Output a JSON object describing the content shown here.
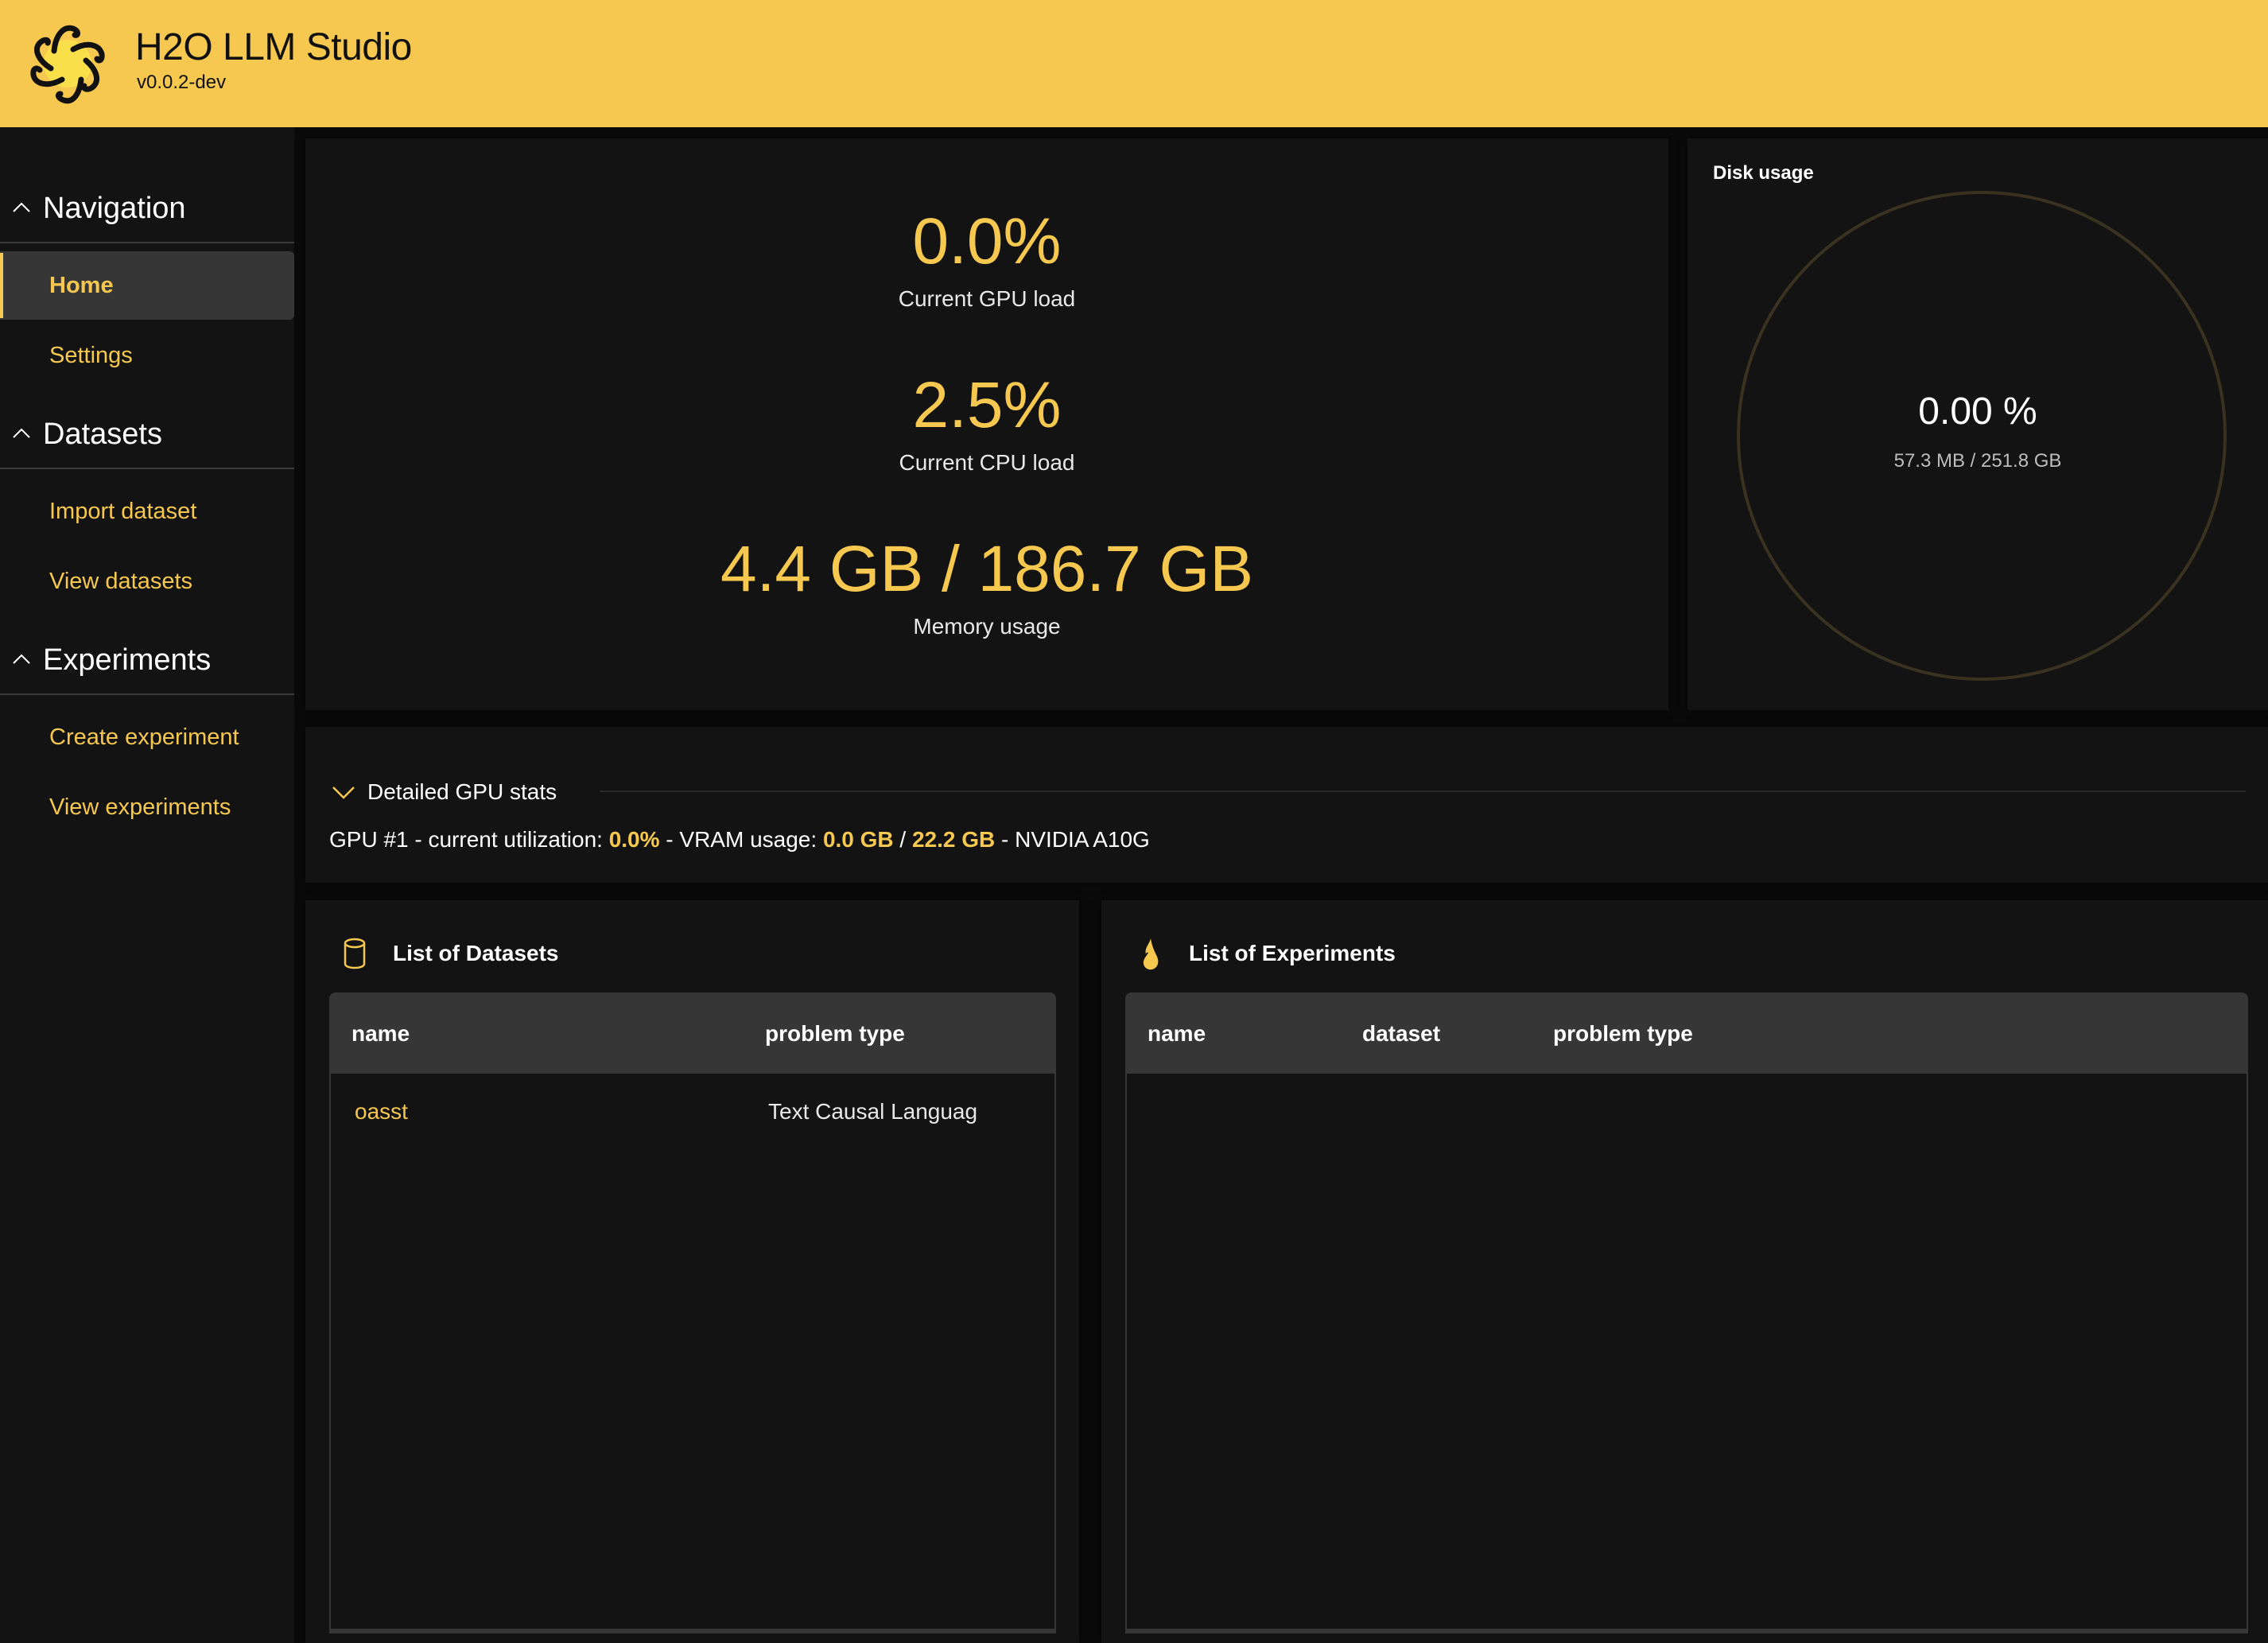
{
  "header": {
    "title": "H2O LLM Studio",
    "version": "v0.0.2-dev",
    "logo_icon": "h2o-spiral-logo",
    "background_color": "#F6C84F"
  },
  "sidebar": {
    "sections": [
      {
        "label": "Navigation",
        "icon": "chevron-up-icon",
        "items": [
          {
            "label": "Home",
            "active": true
          },
          {
            "label": "Settings",
            "active": false
          }
        ]
      },
      {
        "label": "Datasets",
        "icon": "chevron-up-icon",
        "items": [
          {
            "label": "Import dataset",
            "active": false
          },
          {
            "label": "View datasets",
            "active": false
          }
        ]
      },
      {
        "label": "Experiments",
        "icon": "chevron-up-icon",
        "items": [
          {
            "label": "Create experiment",
            "active": false
          },
          {
            "label": "View experiments",
            "active": false
          }
        ]
      }
    ]
  },
  "stats": {
    "gpu_load": {
      "value": "0.0%",
      "label": "Current GPU load"
    },
    "cpu_load": {
      "value": "2.5%",
      "label": "Current CPU load"
    },
    "memory": {
      "value": "4.4 GB / 186.7 GB",
      "label": "Memory usage"
    }
  },
  "disk": {
    "title": "Disk usage",
    "percent_text": "0.00 %",
    "detail": "57.3 MB / 251.8 GB",
    "fraction_used": 0.0
  },
  "gpu_stats": {
    "toggle_label": "Detailed GPU stats",
    "toggle_icon": "chevron-down-icon",
    "gpus": [
      {
        "prefix": "GPU #1 - current utilization: ",
        "utilization": "0.0%",
        "vram_label": " - VRAM usage: ",
        "vram_used": "0.0 GB",
        "separator": " / ",
        "vram_total": "22.2 GB",
        "suffix": " - NVIDIA A10G"
      }
    ]
  },
  "datasets": {
    "title": "List of Datasets",
    "icon": "database-icon",
    "columns": [
      "name",
      "problem type"
    ],
    "rows": [
      {
        "name": "oasst",
        "problem_type": "Text Causal Languag"
      }
    ]
  },
  "experiments": {
    "title": "List of Experiments",
    "icon": "flame-icon",
    "columns": [
      "name",
      "dataset",
      "problem type"
    ],
    "rows": []
  },
  "colors": {
    "accent": "#F6C84F",
    "card_bg": "#131313",
    "page_bg": "#0a0a0a",
    "table_header_bg": "#363636"
  }
}
